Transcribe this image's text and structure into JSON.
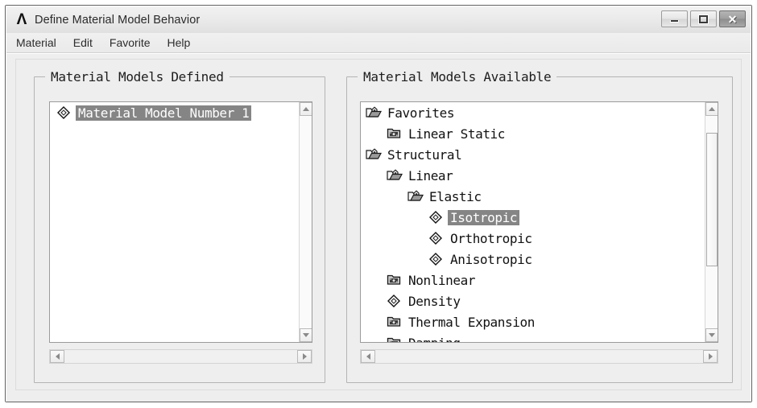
{
  "window": {
    "title": "Define Material Model Behavior",
    "app_icon": "ansys-lambda-icon",
    "buttons": {
      "minimize": "minimize-button",
      "maximize": "maximize-button",
      "close": "✕"
    }
  },
  "menubar": {
    "items": [
      {
        "label": "Material"
      },
      {
        "label": "Edit"
      },
      {
        "label": "Favorite"
      },
      {
        "label": "Help"
      }
    ]
  },
  "panels": {
    "defined": {
      "title": "Material Models Defined",
      "items": [
        {
          "label": "Material Model Number 1",
          "icon": "diamond",
          "indent": 0,
          "selected": true
        }
      ]
    },
    "available": {
      "title": "Material Models Available",
      "items": [
        {
          "label": "Favorites",
          "icon": "folder-open",
          "indent": 0,
          "selected": false
        },
        {
          "label": "Linear Static",
          "icon": "folder-closed",
          "indent": 1,
          "selected": false
        },
        {
          "label": "Structural",
          "icon": "folder-open",
          "indent": 0,
          "selected": false
        },
        {
          "label": "Linear",
          "icon": "folder-open",
          "indent": 1,
          "selected": false
        },
        {
          "label": "Elastic",
          "icon": "folder-open",
          "indent": 2,
          "selected": false
        },
        {
          "label": "Isotropic",
          "icon": "diamond",
          "indent": 3,
          "selected": true
        },
        {
          "label": "Orthotropic",
          "icon": "diamond",
          "indent": 3,
          "selected": false
        },
        {
          "label": "Anisotropic",
          "icon": "diamond",
          "indent": 3,
          "selected": false
        },
        {
          "label": "Nonlinear",
          "icon": "folder-closed",
          "indent": 1,
          "selected": false
        },
        {
          "label": "Density",
          "icon": "diamond",
          "indent": 1,
          "selected": false
        },
        {
          "label": "Thermal Expansion",
          "icon": "folder-closed",
          "indent": 1,
          "selected": false
        },
        {
          "label": "Damping",
          "icon": "folder-closed",
          "indent": 1,
          "selected": false
        }
      ]
    }
  },
  "scrollbars": {
    "available_vertical": {
      "thumb_top_pct": 8,
      "thumb_height_pct": 63
    }
  },
  "colors": {
    "selection_background": "#858585",
    "selection_text": "#ffffff",
    "pane_background": "#ffffff",
    "dialog_background": "#eeeeee",
    "frame_border": "#636363"
  }
}
